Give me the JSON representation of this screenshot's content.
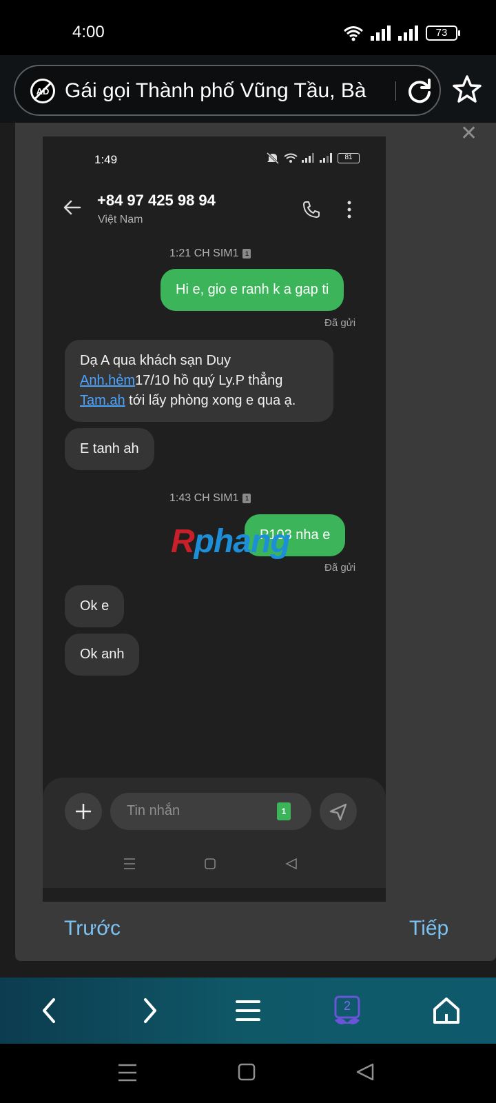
{
  "status_bar": {
    "time": "4:00",
    "battery": "73"
  },
  "browser": {
    "url_title": "Gái gọi Thành phố Vũng Tầu, Bà"
  },
  "overlay": {
    "prev_label": "Trước",
    "next_label": "Tiếp"
  },
  "inner_screenshot": {
    "status_time": "1:49",
    "battery": "81",
    "contact_number": "+84 97 425 98 94",
    "contact_country": "Việt Nam",
    "messages": [
      {
        "meta": "1:21 CH SIM1"
      },
      {
        "direction": "out",
        "text": "Hi e, gio e ranh k a gap ti",
        "status": "Đã gửi"
      },
      {
        "direction": "in",
        "text_1": "Dạ A qua khách sạn Duy ",
        "link_1": "Anh.hẻm",
        "text_2": "17/10 hồ quý Ly.P thẳng ",
        "link_2": "Tam.ah",
        "text_3": " tới lấy phòng xong e qua ạ."
      },
      {
        "direction": "in",
        "text": "E tanh ah"
      },
      {
        "meta": "1:43 CH SIM1"
      },
      {
        "direction": "out",
        "text": "P103 nha e",
        "status": "Đã gửi"
      },
      {
        "direction": "in",
        "text": "Ok e"
      },
      {
        "direction": "in",
        "text": "Ok anh"
      }
    ],
    "sim_icon_label": "1",
    "watermark": {
      "part_1": "R",
      "part_2": "phang"
    },
    "composer": {
      "placeholder": "Tin nhắn",
      "sim_badge": "1"
    }
  },
  "toolbar": {
    "tab_count": "2"
  },
  "colors": {
    "outgoing_bubble": "#3cb55a",
    "incoming_bubble": "#353535",
    "link": "#4aa3ff",
    "nav_text": "#7cc3f2"
  }
}
